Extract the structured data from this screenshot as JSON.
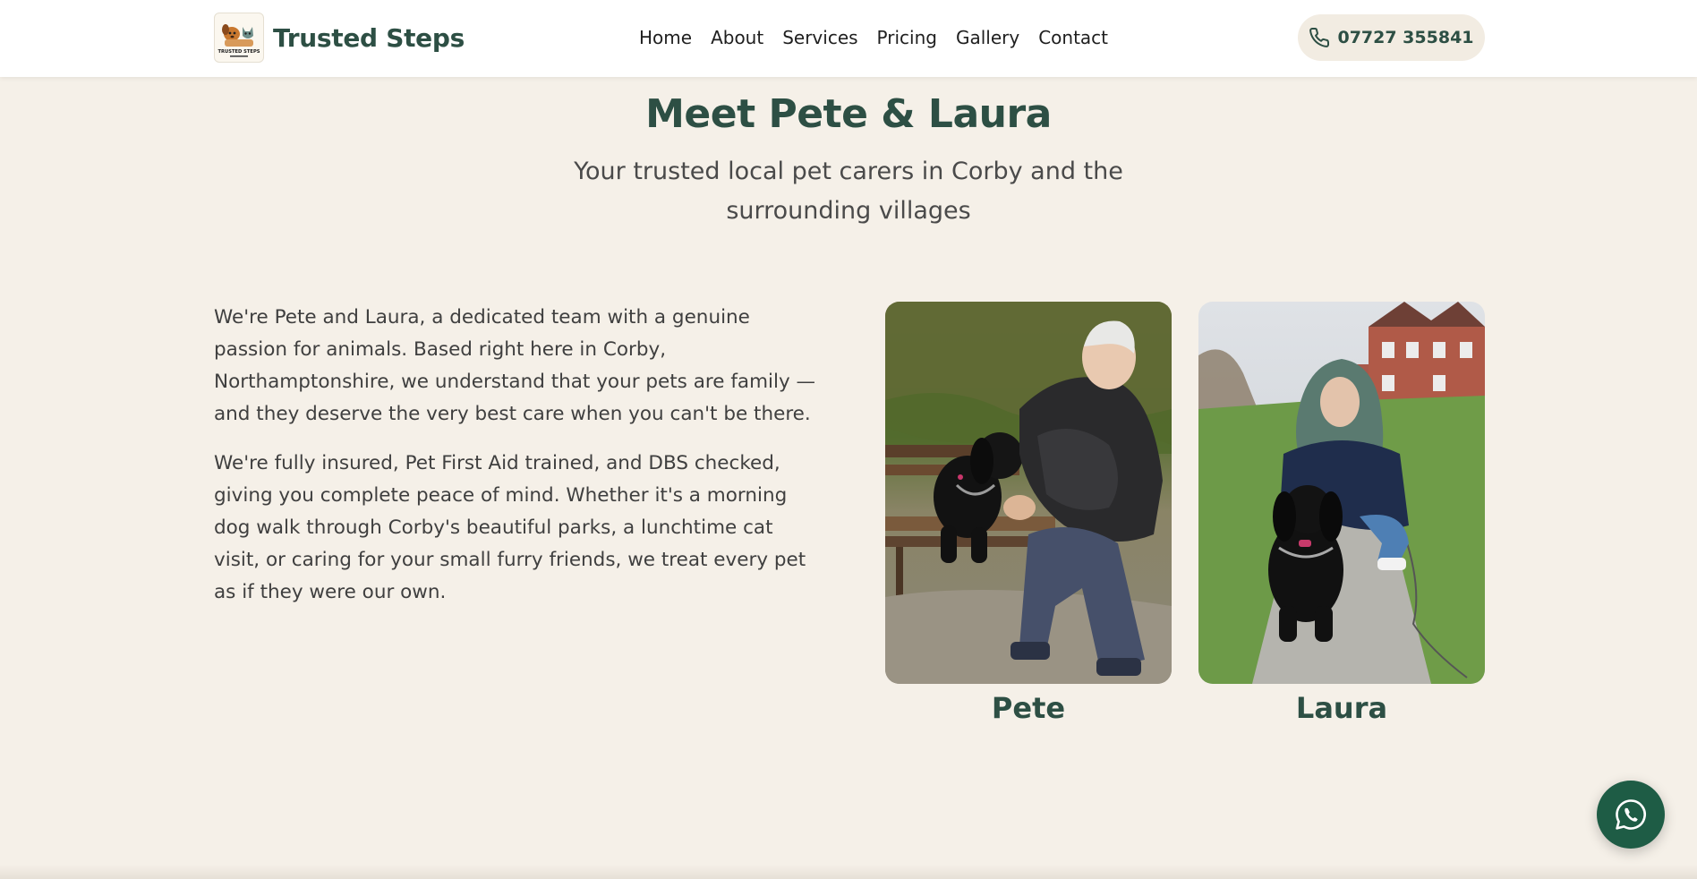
{
  "header": {
    "brand_name": "Trusted Steps",
    "logo_text": "TRUSTED STEPS",
    "nav": [
      "Home",
      "About",
      "Services",
      "Pricing",
      "Gallery",
      "Contact"
    ],
    "phone": "07727 355841"
  },
  "hero": {
    "title": "Meet Pete & Laura",
    "subtitle": "Your trusted local pet carers in Corby and the surrounding villages"
  },
  "intro": {
    "paragraphs": [
      "We're Pete and Laura, a dedicated team with a genuine passion for animals. Based right here in Corby, Northamptonshire, we understand that your pets are family — and they deserve the very best care when you can't be there.",
      "We're fully insured, Pet First Aid trained, and DBS checked, giving you complete peace of mind. Whether it's a morning dog walk through Corby's beautiful parks, a lunchtime cat visit, or caring for your small furry friends, we treat every pet as if they were our own."
    ]
  },
  "team": [
    {
      "name": "Pete"
    },
    {
      "name": "Laura"
    }
  ],
  "icons": {
    "phone": "phone-icon",
    "whatsapp": "whatsapp-icon"
  },
  "colors": {
    "brand_green": "#2d4f44",
    "background": "#f5f0e8",
    "whatsapp_fab": "#1e5c45"
  }
}
